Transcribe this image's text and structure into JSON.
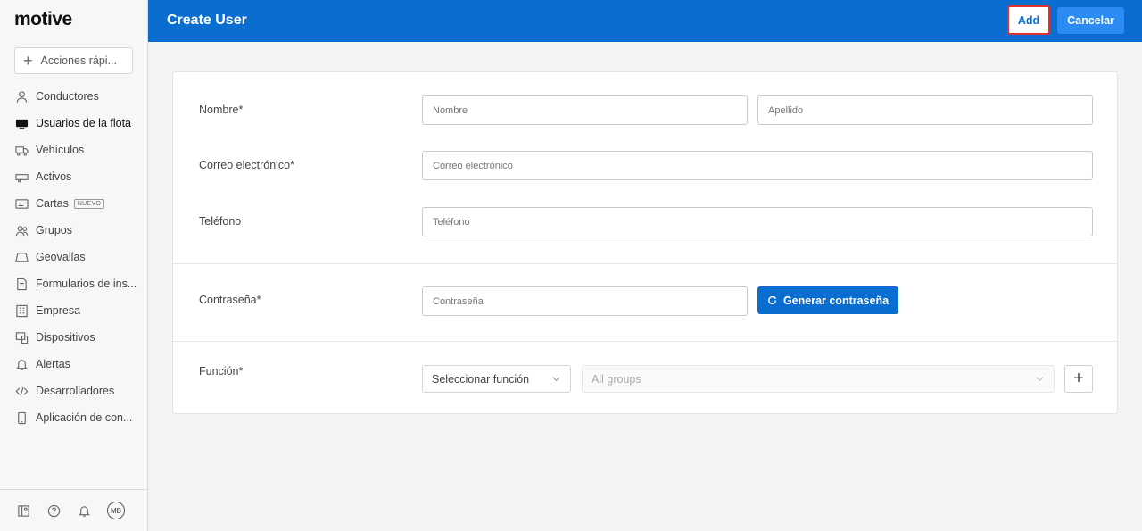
{
  "brand": {
    "logo": "motive"
  },
  "sidebar": {
    "quick_actions": "Acciones rápi...",
    "items": [
      {
        "label": "Conductores",
        "icon": "person-icon"
      },
      {
        "label": "Usuarios de la flota",
        "icon": "monitor-icon",
        "active": true
      },
      {
        "label": "Vehículos",
        "icon": "truck-icon"
      },
      {
        "label": "Activos",
        "icon": "trailer-icon"
      },
      {
        "label": "Cartas",
        "icon": "card-icon",
        "badge": "NUEVO"
      },
      {
        "label": "Grupos",
        "icon": "group-icon"
      },
      {
        "label": "Geovallas",
        "icon": "geofence-icon"
      },
      {
        "label": "Formularios de ins...",
        "icon": "document-icon"
      },
      {
        "label": "Empresa",
        "icon": "building-icon"
      },
      {
        "label": "Dispositivos",
        "icon": "devices-icon"
      },
      {
        "label": "Alertas",
        "icon": "bell-icon"
      },
      {
        "label": "Desarrolladores",
        "icon": "code-icon"
      },
      {
        "label": "Aplicación de con...",
        "icon": "phone-icon"
      }
    ],
    "user_initials": "MB"
  },
  "header": {
    "title": "Create User",
    "add_label": "Add",
    "cancel_label": "Cancelar"
  },
  "form": {
    "name_label": "Nombre*",
    "first_name_placeholder": "Nombre",
    "last_name_placeholder": "Apellido",
    "email_label": "Correo electrónico*",
    "email_placeholder": "Correo electrónico",
    "phone_label": "Teléfono",
    "phone_placeholder": "Teléfono",
    "password_label": "Contraseña*",
    "password_placeholder": "Contraseña",
    "generate_password_label": "Generar contraseña",
    "role_label": "Función*",
    "role_select": "Seleccionar función",
    "groups_select": "All groups"
  },
  "colors": {
    "primary": "#0a6ed1",
    "accent_light": "#2c8cf4",
    "highlight_border": "#e03030"
  }
}
